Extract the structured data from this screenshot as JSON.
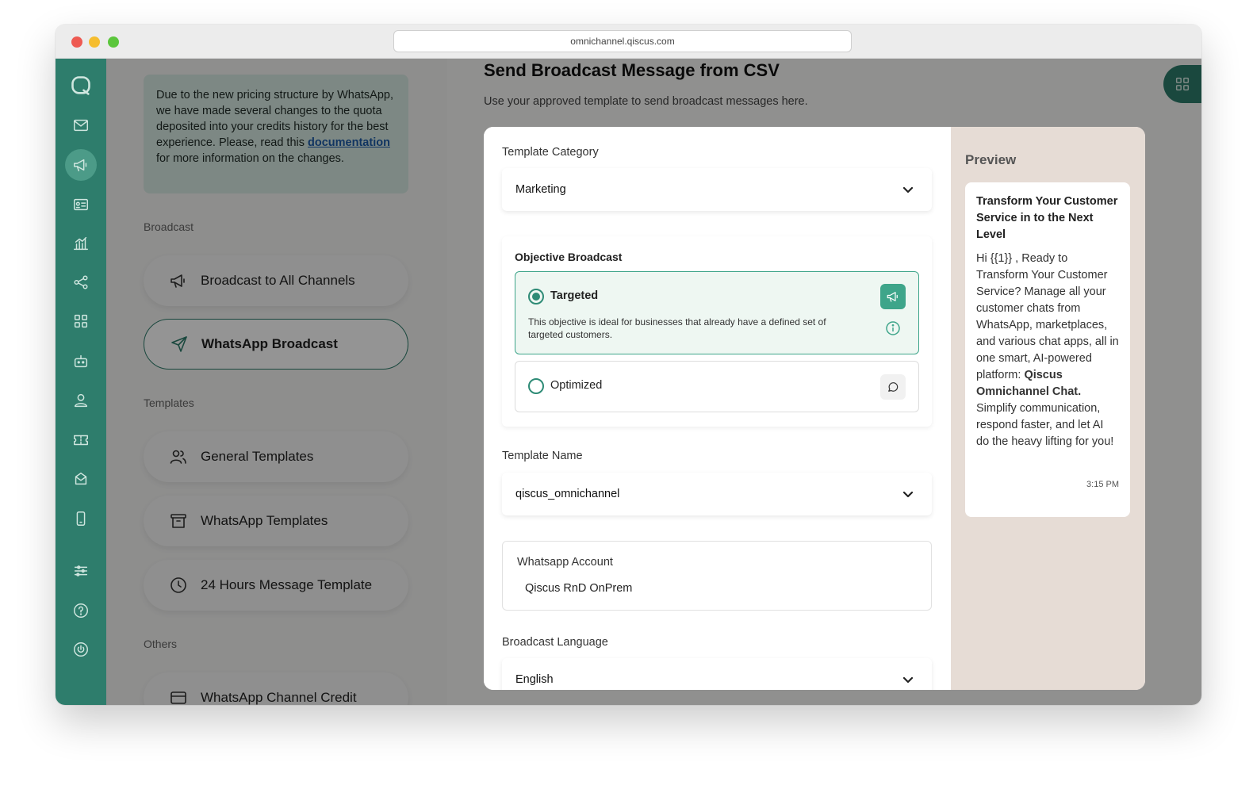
{
  "browser": {
    "url": "omnichannel.qiscus.com"
  },
  "notice": {
    "text_before": "Due to the new pricing structure by WhatsApp, we have made several changes to the quota deposited into your credits history for the best experience. Please, read this ",
    "link": "documentation",
    "text_after": " for more information on the changes."
  },
  "menu": {
    "broadcast_label": "Broadcast",
    "broadcast_all": "Broadcast to All Channels",
    "whatsapp_broadcast": "WhatsApp Broadcast",
    "templates_label": "Templates",
    "general_templates": "General Templates",
    "whatsapp_templates": "WhatsApp Templates",
    "hours_template": "24 Hours Message Template",
    "others_label": "Others",
    "channel_credit": "WhatsApp Channel Credit"
  },
  "page": {
    "title": "Send Broadcast Message from CSV",
    "subtitle": "Use your approved template to send broadcast messages here."
  },
  "form": {
    "category_label": "Template Category",
    "category_value": "Marketing",
    "objective_title": "Objective Broadcast",
    "targeted_label": "Targeted",
    "targeted_desc": "This objective is ideal for businesses that already have a defined set of targeted customers.",
    "optimized_label": "Optimized",
    "template_name_label": "Template Name",
    "template_name_value": "qiscus_omnichannel",
    "account_label": "Whatsapp Account",
    "account_value": "Qiscus RnD OnPrem",
    "language_label": "Broadcast Language",
    "language_value": "English"
  },
  "preview": {
    "title": "Preview",
    "header": "Transform Your Customer Service in to the Next Level",
    "body_start": "Hi {{1}} , Ready to Transform Your Customer Service? Manage all your customer chats from WhatsApp, marketplaces, and various chat apps, all in one smart, AI-powered platform: ",
    "body_bold": "Qiscus Omnichannel Chat.",
    "body_end": " Simplify communication, respond faster, and let AI do the heavy lifting for you!",
    "time": "3:15 PM"
  },
  "colors": {
    "rail": "#2e7d6c",
    "accent": "#3ea58a",
    "preview_bg": "#e6dcd5"
  },
  "icons": {
    "rail": [
      "qiscus-logo-icon",
      "inbox-icon",
      "megaphone-icon",
      "contact-card-icon",
      "analytics-icon",
      "share-icon",
      "apps-icon",
      "bot-icon",
      "agent-icon",
      "ticket-icon",
      "mailbox-icon",
      "mobile-icon",
      "settings-sliders-icon",
      "help-icon",
      "power-icon"
    ]
  }
}
